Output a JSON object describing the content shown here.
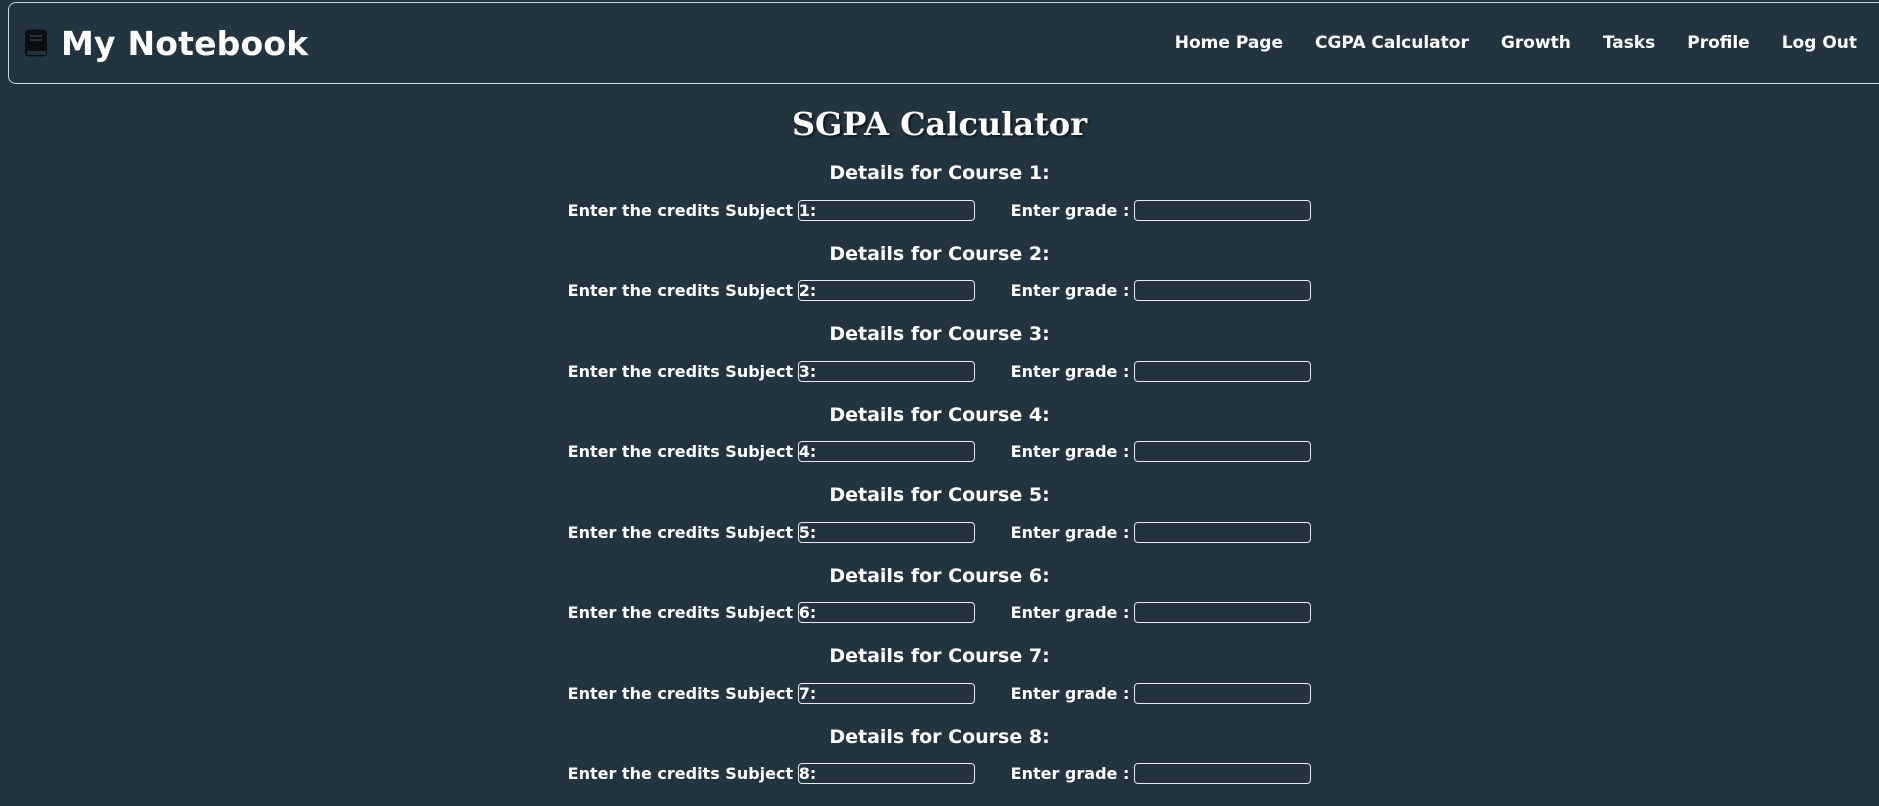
{
  "header": {
    "brand_icon": "book-icon",
    "brand_title": "My Notebook",
    "nav": [
      {
        "label": "Home Page"
      },
      {
        "label": "CGPA Calculator"
      },
      {
        "label": "Growth"
      },
      {
        "label": "Tasks"
      },
      {
        "label": "Profile"
      },
      {
        "label": "Log Out"
      }
    ]
  },
  "main": {
    "title": "SGPA Calculator",
    "courses": [
      {
        "heading": "Details for Course 1:",
        "credits_label": "Enter the credits Subject 1:",
        "credits_value": "",
        "grade_label": "Enter grade :",
        "grade_value": ""
      },
      {
        "heading": "Details for Course 2:",
        "credits_label": "Enter the credits Subject 2:",
        "credits_value": "",
        "grade_label": "Enter grade :",
        "grade_value": ""
      },
      {
        "heading": "Details for Course 3:",
        "credits_label": "Enter the credits Subject 3:",
        "credits_value": "",
        "grade_label": "Enter grade :",
        "grade_value": ""
      },
      {
        "heading": "Details for Course 4:",
        "credits_label": "Enter the credits Subject 4:",
        "credits_value": "",
        "grade_label": "Enter grade :",
        "grade_value": ""
      },
      {
        "heading": "Details for Course 5:",
        "credits_label": "Enter the credits Subject 5:",
        "credits_value": "",
        "grade_label": "Enter grade :",
        "grade_value": ""
      },
      {
        "heading": "Details for Course 6:",
        "credits_label": "Enter the credits Subject 6:",
        "credits_value": "",
        "grade_label": "Enter grade :",
        "grade_value": ""
      },
      {
        "heading": "Details for Course 7:",
        "credits_label": "Enter the credits Subject 7:",
        "credits_value": "",
        "grade_label": "Enter grade :",
        "grade_value": ""
      },
      {
        "heading": "Details for Course 8:",
        "credits_label": "Enter the credits Subject 8:",
        "credits_value": "",
        "grade_label": "Enter grade :",
        "grade_value": ""
      }
    ]
  },
  "colors": {
    "background": "#233441",
    "text": "#ffffff",
    "border": "#cfd6dc"
  }
}
